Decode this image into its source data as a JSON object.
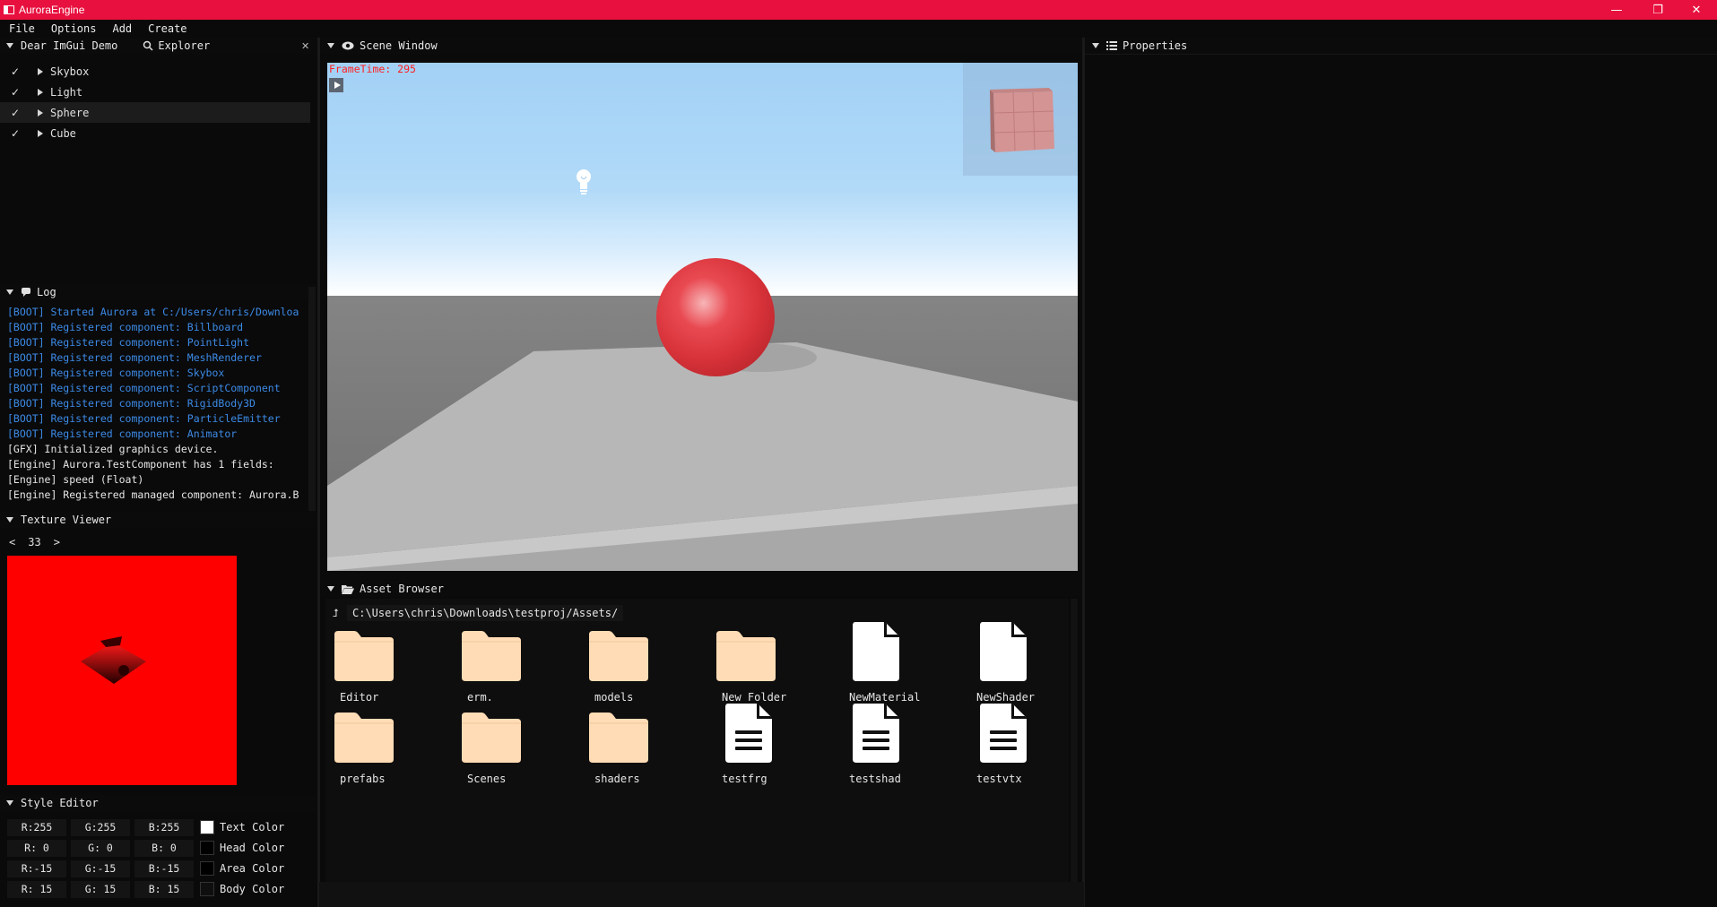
{
  "window": {
    "title": "AuroraEngine",
    "controls": {
      "minimize": "—",
      "restore": "❐",
      "close": "✕"
    }
  },
  "menu": [
    "File",
    "Options",
    "Add",
    "Create"
  ],
  "left_tabs": {
    "demo": "Dear ImGui Demo",
    "explorer": "Explorer",
    "close": "✕"
  },
  "explorer": {
    "items": [
      {
        "label": "Skybox",
        "checked": "✓"
      },
      {
        "label": "Light",
        "checked": "✓"
      },
      {
        "label": "Sphere",
        "checked": "✓"
      },
      {
        "label": "Cube",
        "checked": "✓"
      }
    ]
  },
  "log": {
    "title": "Log",
    "lines": [
      {
        "text": "[BOOT] Started Aurora at C:/Users/chris/Downloa",
        "type": "boot"
      },
      {
        "text": "[BOOT] Registered component: Billboard",
        "type": "boot"
      },
      {
        "text": "[BOOT] Registered component: PointLight",
        "type": "boot"
      },
      {
        "text": "[BOOT] Registered component: MeshRenderer",
        "type": "boot"
      },
      {
        "text": "[BOOT] Registered component: Skybox",
        "type": "boot"
      },
      {
        "text": "[BOOT] Registered component: ScriptComponent",
        "type": "boot"
      },
      {
        "text": "[BOOT] Registered component: RigidBody3D",
        "type": "boot"
      },
      {
        "text": "[BOOT] Registered component: ParticleEmitter",
        "type": "boot"
      },
      {
        "text": "[BOOT] Registered component: Animator",
        "type": "boot"
      },
      {
        "text": "[GFX] Initialized graphics device.",
        "type": "norm"
      },
      {
        "text": "[Engine] Aurora.TestComponent has 1 fields:",
        "type": "norm"
      },
      {
        "text": "[Engine]    speed (Float)",
        "type": "norm"
      },
      {
        "text": "[Engine] Registered managed component: Aurora.B",
        "type": "norm"
      }
    ]
  },
  "texture_viewer": {
    "title": "Texture Viewer",
    "prev": "<",
    "index": "33",
    "next": ">"
  },
  "style_editor": {
    "title": "Style Editor",
    "rows": [
      {
        "r": "R:255",
        "g": "G:255",
        "b": "B:255",
        "label": "Text Color",
        "color": "#ffffff"
      },
      {
        "r": "R:  0",
        "g": "G:  0",
        "b": "B:  0",
        "label": "Head Color",
        "color": "#000000"
      },
      {
        "r": "R:-15",
        "g": "G:-15",
        "b": "B:-15",
        "label": "Area Color",
        "color": "#000000"
      },
      {
        "r": "R: 15",
        "g": "G: 15",
        "b": "B: 15",
        "label": "Body Color",
        "color": "#0f0f0f"
      }
    ]
  },
  "scene": {
    "title": "Scene Window",
    "frametime": "FrameTime: 295"
  },
  "properties": {
    "title": "Properties"
  },
  "assets": {
    "title": "Asset Browser",
    "up": "⮥",
    "path": "C:\\Users\\chris\\Downloads\\testproj/Assets/",
    "items": [
      {
        "label": "Editor",
        "kind": "folder"
      },
      {
        "label": "erm.",
        "kind": "folder"
      },
      {
        "label": "models",
        "kind": "folder"
      },
      {
        "label": "New Folder",
        "kind": "folder"
      },
      {
        "label": "NewMaterial",
        "kind": "file"
      },
      {
        "label": "NewShader",
        "kind": "file"
      },
      {
        "label": "prefabs",
        "kind": "folder"
      },
      {
        "label": "Scenes",
        "kind": "folder"
      },
      {
        "label": "shaders",
        "kind": "folder"
      },
      {
        "label": "testfrg",
        "kind": "textfile"
      },
      {
        "label": "testshad",
        "kind": "textfile"
      },
      {
        "label": "testvtx",
        "kind": "textfile"
      }
    ]
  },
  "colors": {
    "titlebar": "#e8103e",
    "folder": "#ffdcb5",
    "boot_log": "#3c8ae6",
    "frametime": "#ff2020"
  }
}
